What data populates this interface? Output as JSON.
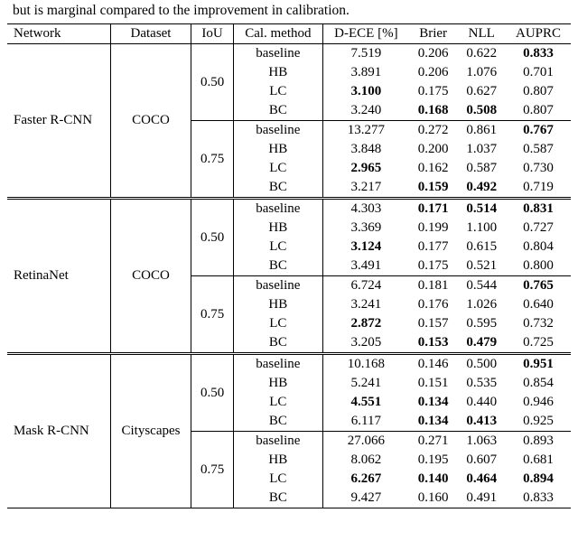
{
  "intro": "but is marginal compared to the improvement in calibration.",
  "headers": {
    "network": "Network",
    "dataset": "Dataset",
    "iou": "IoU",
    "method": "Cal. method",
    "dece": "D-ECE [%]",
    "brier": "Brier",
    "nll": "NLL",
    "auprc": "AUPRC"
  },
  "chart_data": {
    "type": "table",
    "title": "",
    "columns": [
      "Network",
      "Dataset",
      "IoU",
      "Cal. method",
      "D-ECE [%]",
      "Brier",
      "NLL",
      "AUPRC"
    ],
    "groups": [
      {
        "network": "Faster R-CNN",
        "dataset": "COCO",
        "subgroups": [
          {
            "iou": "0.50",
            "rows": [
              {
                "method": "baseline",
                "dece": {
                  "v": "7.519",
                  "b": false
                },
                "brier": {
                  "v": "0.206",
                  "b": false
                },
                "nll": {
                  "v": "0.622",
                  "b": false
                },
                "auprc": {
                  "v": "0.833",
                  "b": true
                }
              },
              {
                "method": "HB",
                "dece": {
                  "v": "3.891",
                  "b": false
                },
                "brier": {
                  "v": "0.206",
                  "b": false
                },
                "nll": {
                  "v": "1.076",
                  "b": false
                },
                "auprc": {
                  "v": "0.701",
                  "b": false
                }
              },
              {
                "method": "LC",
                "dece": {
                  "v": "3.100",
                  "b": true
                },
                "brier": {
                  "v": "0.175",
                  "b": false
                },
                "nll": {
                  "v": "0.627",
                  "b": false
                },
                "auprc": {
                  "v": "0.807",
                  "b": false
                }
              },
              {
                "method": "BC",
                "dece": {
                  "v": "3.240",
                  "b": false
                },
                "brier": {
                  "v": "0.168",
                  "b": true
                },
                "nll": {
                  "v": "0.508",
                  "b": true
                },
                "auprc": {
                  "v": "0.807",
                  "b": false
                }
              }
            ]
          },
          {
            "iou": "0.75",
            "rows": [
              {
                "method": "baseline",
                "dece": {
                  "v": "13.277",
                  "b": false
                },
                "brier": {
                  "v": "0.272",
                  "b": false
                },
                "nll": {
                  "v": "0.861",
                  "b": false
                },
                "auprc": {
                  "v": "0.767",
                  "b": true
                }
              },
              {
                "method": "HB",
                "dece": {
                  "v": "3.848",
                  "b": false
                },
                "brier": {
                  "v": "0.200",
                  "b": false
                },
                "nll": {
                  "v": "1.037",
                  "b": false
                },
                "auprc": {
                  "v": "0.587",
                  "b": false
                }
              },
              {
                "method": "LC",
                "dece": {
                  "v": "2.965",
                  "b": true
                },
                "brier": {
                  "v": "0.162",
                  "b": false
                },
                "nll": {
                  "v": "0.587",
                  "b": false
                },
                "auprc": {
                  "v": "0.730",
                  "b": false
                }
              },
              {
                "method": "BC",
                "dece": {
                  "v": "3.217",
                  "b": false
                },
                "brier": {
                  "v": "0.159",
                  "b": true
                },
                "nll": {
                  "v": "0.492",
                  "b": true
                },
                "auprc": {
                  "v": "0.719",
                  "b": false
                }
              }
            ]
          }
        ]
      },
      {
        "network": "RetinaNet",
        "dataset": "COCO",
        "subgroups": [
          {
            "iou": "0.50",
            "rows": [
              {
                "method": "baseline",
                "dece": {
                  "v": "4.303",
                  "b": false
                },
                "brier": {
                  "v": "0.171",
                  "b": true
                },
                "nll": {
                  "v": "0.514",
                  "b": true
                },
                "auprc": {
                  "v": "0.831",
                  "b": true
                }
              },
              {
                "method": "HB",
                "dece": {
                  "v": "3.369",
                  "b": false
                },
                "brier": {
                  "v": "0.199",
                  "b": false
                },
                "nll": {
                  "v": "1.100",
                  "b": false
                },
                "auprc": {
                  "v": "0.727",
                  "b": false
                }
              },
              {
                "method": "LC",
                "dece": {
                  "v": "3.124",
                  "b": true
                },
                "brier": {
                  "v": "0.177",
                  "b": false
                },
                "nll": {
                  "v": "0.615",
                  "b": false
                },
                "auprc": {
                  "v": "0.804",
                  "b": false
                }
              },
              {
                "method": "BC",
                "dece": {
                  "v": "3.491",
                  "b": false
                },
                "brier": {
                  "v": "0.175",
                  "b": false
                },
                "nll": {
                  "v": "0.521",
                  "b": false
                },
                "auprc": {
                  "v": "0.800",
                  "b": false
                }
              }
            ]
          },
          {
            "iou": "0.75",
            "rows": [
              {
                "method": "baseline",
                "dece": {
                  "v": "6.724",
                  "b": false
                },
                "brier": {
                  "v": "0.181",
                  "b": false
                },
                "nll": {
                  "v": "0.544",
                  "b": false
                },
                "auprc": {
                  "v": "0.765",
                  "b": true
                }
              },
              {
                "method": "HB",
                "dece": {
                  "v": "3.241",
                  "b": false
                },
                "brier": {
                  "v": "0.176",
                  "b": false
                },
                "nll": {
                  "v": "1.026",
                  "b": false
                },
                "auprc": {
                  "v": "0.640",
                  "b": false
                }
              },
              {
                "method": "LC",
                "dece": {
                  "v": "2.872",
                  "b": true
                },
                "brier": {
                  "v": "0.157",
                  "b": false
                },
                "nll": {
                  "v": "0.595",
                  "b": false
                },
                "auprc": {
                  "v": "0.732",
                  "b": false
                }
              },
              {
                "method": "BC",
                "dece": {
                  "v": "3.205",
                  "b": false
                },
                "brier": {
                  "v": "0.153",
                  "b": true
                },
                "nll": {
                  "v": "0.479",
                  "b": true
                },
                "auprc": {
                  "v": "0.725",
                  "b": false
                }
              }
            ]
          }
        ]
      },
      {
        "network": "Mask R-CNN",
        "dataset": "Cityscapes",
        "subgroups": [
          {
            "iou": "0.50",
            "rows": [
              {
                "method": "baseline",
                "dece": {
                  "v": "10.168",
                  "b": false
                },
                "brier": {
                  "v": "0.146",
                  "b": false
                },
                "nll": {
                  "v": "0.500",
                  "b": false
                },
                "auprc": {
                  "v": "0.951",
                  "b": true
                }
              },
              {
                "method": "HB",
                "dece": {
                  "v": "5.241",
                  "b": false
                },
                "brier": {
                  "v": "0.151",
                  "b": false
                },
                "nll": {
                  "v": "0.535",
                  "b": false
                },
                "auprc": {
                  "v": "0.854",
                  "b": false
                }
              },
              {
                "method": "LC",
                "dece": {
                  "v": "4.551",
                  "b": true
                },
                "brier": {
                  "v": "0.134",
                  "b": true
                },
                "nll": {
                  "v": "0.440",
                  "b": false
                },
                "auprc": {
                  "v": "0.946",
                  "b": false
                }
              },
              {
                "method": "BC",
                "dece": {
                  "v": "6.117",
                  "b": false
                },
                "brier": {
                  "v": "0.134",
                  "b": true
                },
                "nll": {
                  "v": "0.413",
                  "b": true
                },
                "auprc": {
                  "v": "0.925",
                  "b": false
                }
              }
            ]
          },
          {
            "iou": "0.75",
            "rows": [
              {
                "method": "baseline",
                "dece": {
                  "v": "27.066",
                  "b": false
                },
                "brier": {
                  "v": "0.271",
                  "b": false
                },
                "nll": {
                  "v": "1.063",
                  "b": false
                },
                "auprc": {
                  "v": "0.893",
                  "b": false
                }
              },
              {
                "method": "HB",
                "dece": {
                  "v": "8.062",
                  "b": false
                },
                "brier": {
                  "v": "0.195",
                  "b": false
                },
                "nll": {
                  "v": "0.607",
                  "b": false
                },
                "auprc": {
                  "v": "0.681",
                  "b": false
                }
              },
              {
                "method": "LC",
                "dece": {
                  "v": "6.267",
                  "b": true
                },
                "brier": {
                  "v": "0.140",
                  "b": true
                },
                "nll": {
                  "v": "0.464",
                  "b": true
                },
                "auprc": {
                  "v": "0.894",
                  "b": true
                }
              },
              {
                "method": "BC",
                "dece": {
                  "v": "9.427",
                  "b": false
                },
                "brier": {
                  "v": "0.160",
                  "b": false
                },
                "nll": {
                  "v": "0.491",
                  "b": false
                },
                "auprc": {
                  "v": "0.833",
                  "b": false
                }
              }
            ]
          }
        ]
      }
    ]
  }
}
